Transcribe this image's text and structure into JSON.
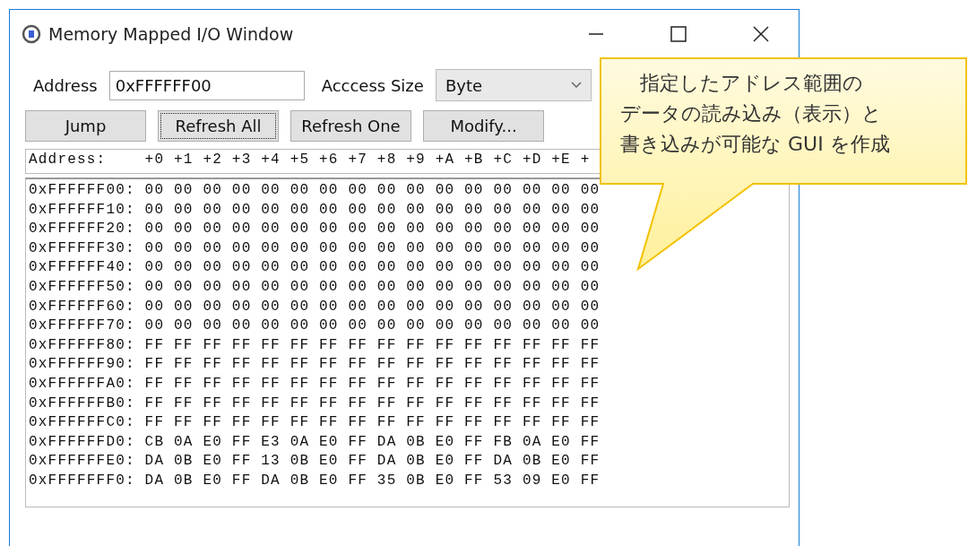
{
  "window": {
    "title": "Memory Mapped I/O Window"
  },
  "address": {
    "label": "Address",
    "value": "0xFFFFFF00"
  },
  "access_size": {
    "label": "Acccess Size",
    "value": "Byte"
  },
  "buttons": [
    {
      "label": "Jump",
      "focused": false
    },
    {
      "label": "Refresh All",
      "focused": true
    },
    {
      "label": "Refresh One",
      "focused": false
    },
    {
      "label": "Modify...",
      "focused": false
    }
  ],
  "dump": {
    "header": "Address:    +0 +1 +2 +3 +4 +5 +6 +7 +8 +9 +A +B +C +D +E +",
    "rows": [
      {
        "address": "0xFFFFFF00:",
        "bytes": [
          "00",
          "00",
          "00",
          "00",
          "00",
          "00",
          "00",
          "00",
          "00",
          "00",
          "00",
          "00",
          "00",
          "00",
          "00",
          "00"
        ]
      },
      {
        "address": "0xFFFFFF10:",
        "bytes": [
          "00",
          "00",
          "00",
          "00",
          "00",
          "00",
          "00",
          "00",
          "00",
          "00",
          "00",
          "00",
          "00",
          "00",
          "00",
          "00"
        ]
      },
      {
        "address": "0xFFFFFF20:",
        "bytes": [
          "00",
          "00",
          "00",
          "00",
          "00",
          "00",
          "00",
          "00",
          "00",
          "00",
          "00",
          "00",
          "00",
          "00",
          "00",
          "00"
        ]
      },
      {
        "address": "0xFFFFFF30:",
        "bytes": [
          "00",
          "00",
          "00",
          "00",
          "00",
          "00",
          "00",
          "00",
          "00",
          "00",
          "00",
          "00",
          "00",
          "00",
          "00",
          "00"
        ]
      },
      {
        "address": "0xFFFFFF40:",
        "bytes": [
          "00",
          "00",
          "00",
          "00",
          "00",
          "00",
          "00",
          "00",
          "00",
          "00",
          "00",
          "00",
          "00",
          "00",
          "00",
          "00"
        ]
      },
      {
        "address": "0xFFFFFF50:",
        "bytes": [
          "00",
          "00",
          "00",
          "00",
          "00",
          "00",
          "00",
          "00",
          "00",
          "00",
          "00",
          "00",
          "00",
          "00",
          "00",
          "00"
        ]
      },
      {
        "address": "0xFFFFFF60:",
        "bytes": [
          "00",
          "00",
          "00",
          "00",
          "00",
          "00",
          "00",
          "00",
          "00",
          "00",
          "00",
          "00",
          "00",
          "00",
          "00",
          "00"
        ]
      },
      {
        "address": "0xFFFFFF70:",
        "bytes": [
          "00",
          "00",
          "00",
          "00",
          "00",
          "00",
          "00",
          "00",
          "00",
          "00",
          "00",
          "00",
          "00",
          "00",
          "00",
          "00"
        ]
      },
      {
        "address": "0xFFFFFF80:",
        "bytes": [
          "FF",
          "FF",
          "FF",
          "FF",
          "FF",
          "FF",
          "FF",
          "FF",
          "FF",
          "FF",
          "FF",
          "FF",
          "FF",
          "FF",
          "FF",
          "FF"
        ]
      },
      {
        "address": "0xFFFFFF90:",
        "bytes": [
          "FF",
          "FF",
          "FF",
          "FF",
          "FF",
          "FF",
          "FF",
          "FF",
          "FF",
          "FF",
          "FF",
          "FF",
          "FF",
          "FF",
          "FF",
          "FF"
        ]
      },
      {
        "address": "0xFFFFFFA0:",
        "bytes": [
          "FF",
          "FF",
          "FF",
          "FF",
          "FF",
          "FF",
          "FF",
          "FF",
          "FF",
          "FF",
          "FF",
          "FF",
          "FF",
          "FF",
          "FF",
          "FF"
        ]
      },
      {
        "address": "0xFFFFFFB0:",
        "bytes": [
          "FF",
          "FF",
          "FF",
          "FF",
          "FF",
          "FF",
          "FF",
          "FF",
          "FF",
          "FF",
          "FF",
          "FF",
          "FF",
          "FF",
          "FF",
          "FF"
        ]
      },
      {
        "address": "0xFFFFFFC0:",
        "bytes": [
          "FF",
          "FF",
          "FF",
          "FF",
          "FF",
          "FF",
          "FF",
          "FF",
          "FF",
          "FF",
          "FF",
          "FF",
          "FF",
          "FF",
          "FF",
          "FF"
        ]
      },
      {
        "address": "0xFFFFFFD0:",
        "bytes": [
          "CB",
          "0A",
          "E0",
          "FF",
          "E3",
          "0A",
          "E0",
          "FF",
          "DA",
          "0B",
          "E0",
          "FF",
          "FB",
          "0A",
          "E0",
          "FF"
        ]
      },
      {
        "address": "0xFFFFFFE0:",
        "bytes": [
          "DA",
          "0B",
          "E0",
          "FF",
          "13",
          "0B",
          "E0",
          "FF",
          "DA",
          "0B",
          "E0",
          "FF",
          "DA",
          "0B",
          "E0",
          "FF"
        ]
      },
      {
        "address": "0xFFFFFFF0:",
        "bytes": [
          "DA",
          "0B",
          "E0",
          "FF",
          "DA",
          "0B",
          "E0",
          "FF",
          "35",
          "0B",
          "E0",
          "FF",
          "53",
          "09",
          "E0",
          "FF"
        ]
      }
    ]
  },
  "callout": {
    "lines": [
      "指定したアドレス範囲の",
      "データの読み込み（表示）と",
      "書き込みが可能な GUI を作成"
    ]
  }
}
